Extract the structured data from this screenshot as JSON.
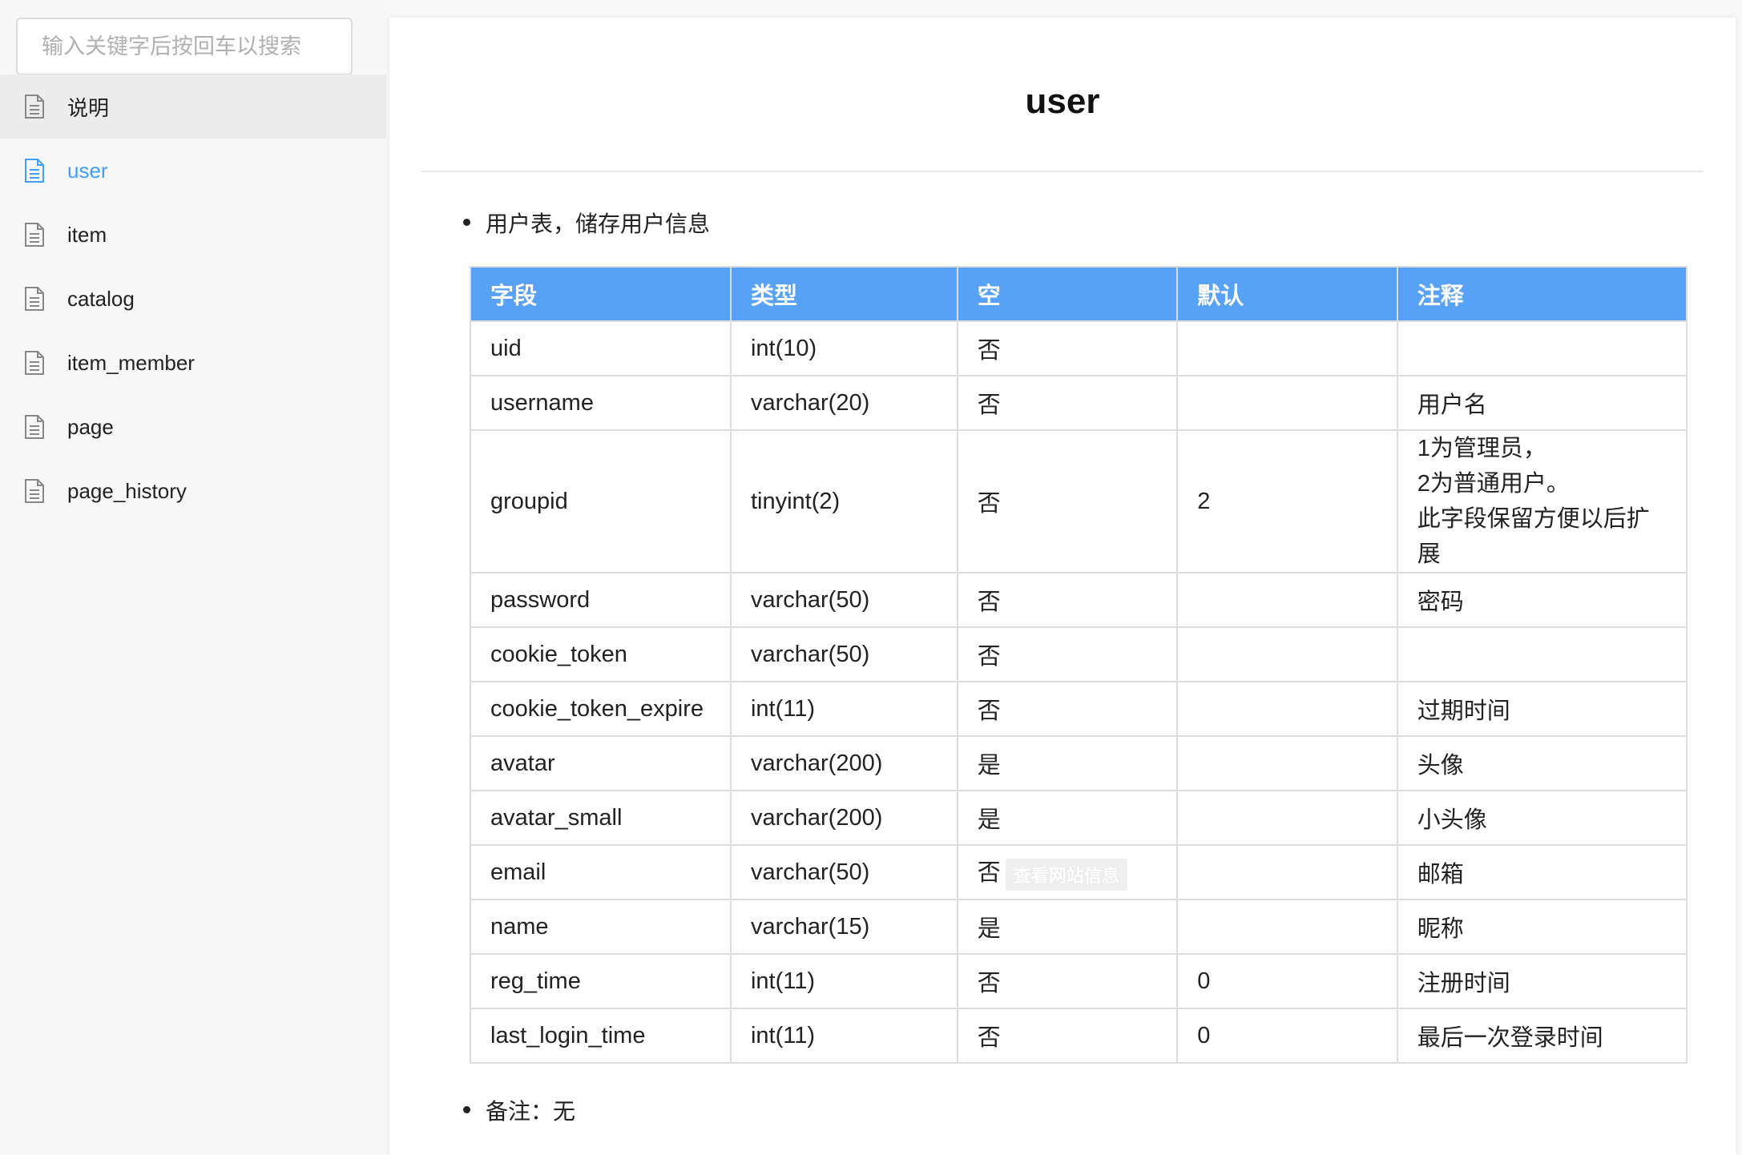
{
  "sidebar": {
    "search_placeholder": "输入关键字后按回车以搜索",
    "items": [
      {
        "label": "说明"
      },
      {
        "label": "user"
      },
      {
        "label": "item"
      },
      {
        "label": "catalog"
      },
      {
        "label": "item_member"
      },
      {
        "label": "page"
      },
      {
        "label": "page_history"
      }
    ]
  },
  "main": {
    "title": "user",
    "description": "用户表，储存用户信息",
    "table": {
      "headers": [
        "字段",
        "类型",
        "空",
        "默认",
        "注释"
      ],
      "rows": [
        [
          "uid",
          "int(10)",
          "否",
          "",
          ""
        ],
        [
          "username",
          "varchar(20)",
          "否",
          "",
          "用户名"
        ],
        [
          "groupid",
          "tinyint(2)",
          "否",
          "2",
          ""
        ],
        [
          "password",
          "varchar(50)",
          "否",
          "",
          "密码"
        ],
        [
          "cookie_token",
          "varchar(50)",
          "否",
          "",
          ""
        ],
        [
          "cookie_token_expire",
          "int(11)",
          "否",
          "",
          "过期时间"
        ],
        [
          "avatar",
          "varchar(200)",
          "是",
          "",
          "头像"
        ],
        [
          "avatar_small",
          "varchar(200)",
          "是",
          "",
          "小头像"
        ],
        [
          "email",
          "varchar(50)",
          "否",
          "",
          "邮箱"
        ],
        [
          "name",
          "varchar(15)",
          "是",
          "",
          "昵称"
        ],
        [
          "reg_time",
          "int(11)",
          "否",
          "0",
          "注册时间"
        ],
        [
          "last_login_time",
          "int(11)",
          "否",
          "0",
          "最后一次登录时间"
        ]
      ],
      "groupid_comment_lines": [
        "1为管理员，",
        "2为普通用户。",
        "此字段保留方便以后扩展"
      ]
    },
    "tooltip": "查看网站信息",
    "note": "备注：无"
  },
  "colors": {
    "accent": "#409eff",
    "header_bg": "#57a1f7",
    "sidebar_bg": "#f7f7f7"
  },
  "icons": {
    "nav_item": "document-icon"
  }
}
